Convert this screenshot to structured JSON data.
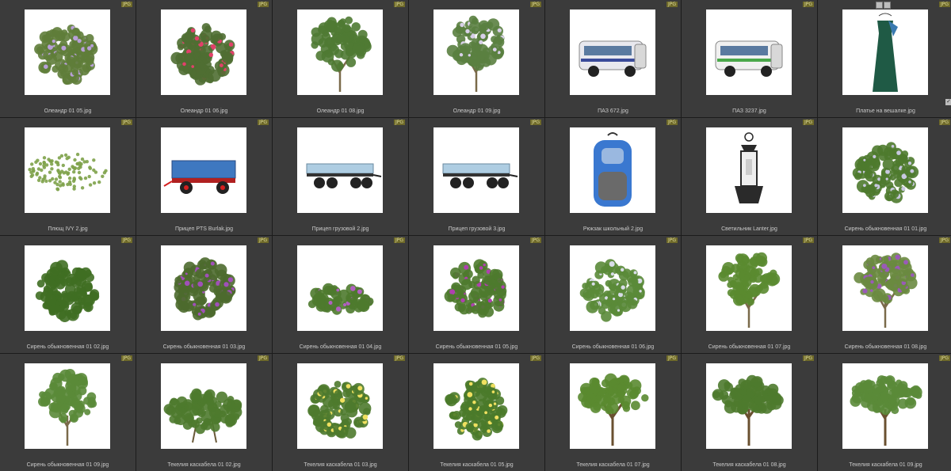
{
  "badge_text": "JPG",
  "items": [
    {
      "name": "Олеандр 01 05.jpg",
      "icon": "round-bush-lilac-flowers-icon",
      "kind": "round",
      "color": "#5f7d3a",
      "flower": "#b8a0d8"
    },
    {
      "name": "Олеандр 01 06.jpg",
      "icon": "round-bush-pink-flowers-icon",
      "kind": "round",
      "color": "#4f6e32",
      "flower": "#e2406a"
    },
    {
      "name": "Олеандр 01 08.jpg",
      "icon": "small-tree-icon",
      "kind": "tree",
      "color": "#4f7a33",
      "flower": ""
    },
    {
      "name": "Олеандр 01 09.jpg",
      "icon": "flowering-tree-icon",
      "kind": "tree",
      "color": "#5a8040",
      "flower": "#d8d0e8"
    },
    {
      "name": "ПАЗ 672.jpg",
      "icon": "bus-icon",
      "kind": "bus",
      "color": "#e8e8ee",
      "flower": "#3a4a9a"
    },
    {
      "name": "ПАЗ 3237.jpg",
      "icon": "bus-icon",
      "kind": "bus2",
      "color": "#f0f0f0",
      "flower": "#4aa84a"
    },
    {
      "name": "Платье на вешалке.jpg",
      "icon": "dress-on-hanger-icon",
      "kind": "dress",
      "color": "#1f5a45",
      "flower": "#3a7ab0"
    },
    {
      "name": "Плющ IVY 2.jpg",
      "icon": "ivy-groundcover-icon",
      "kind": "ivy",
      "color": "#7ea24a",
      "flower": ""
    },
    {
      "name": "Прицеп PTS Burlak.jpg",
      "icon": "farm-trailer-icon",
      "kind": "trailer",
      "color": "#3e78c0",
      "flower": "#d42020"
    },
    {
      "name": "Прицеп грузовой 2.jpg",
      "icon": "cargo-trailer-icon",
      "kind": "flatbed",
      "color": "#aecde2",
      "flower": "#222222"
    },
    {
      "name": "Прицеп грузовой 3.jpg",
      "icon": "cargo-trailer-icon",
      "kind": "flatbed",
      "color": "#aecde2",
      "flower": "#222222"
    },
    {
      "name": "Рюкзак школьный 2.jpg",
      "icon": "backpack-icon",
      "kind": "backpack",
      "color": "#3a78d0",
      "flower": "#6a6a6a"
    },
    {
      "name": "Светильник Lanter.jpg",
      "icon": "lantern-icon",
      "kind": "lantern",
      "color": "#2a2a2a",
      "flower": "#cccccc"
    },
    {
      "name": "Сирень обыкновенная 01 01.jpg",
      "icon": "lilac-bush-icon",
      "kind": "bush",
      "color": "#4e7a2e",
      "flower": "#c8c8e0"
    },
    {
      "name": "Сирень обыкновенная 01 02.jpg",
      "icon": "round-bush-icon",
      "kind": "round",
      "color": "#3f6e22",
      "flower": ""
    },
    {
      "name": "Сирень обыкновенная 01 03.jpg",
      "icon": "round-bush-purple-flowers-icon",
      "kind": "round",
      "color": "#4c6a2e",
      "flower": "#a050b8"
    },
    {
      "name": "Сирень обыкновенная 01 04.jpg",
      "icon": "low-bush-icon",
      "kind": "low",
      "color": "#4e7a2e",
      "flower": "#b060c0"
    },
    {
      "name": "Сирень обыкновенная 01 05.jpg",
      "icon": "lilac-bush-icon",
      "kind": "bush",
      "color": "#4e7a2e",
      "flower": "#b040b0"
    },
    {
      "name": "Сирень обыкновенная 01 06.jpg",
      "icon": "lilac-bush-icon",
      "kind": "bush",
      "color": "#5a8a38",
      "flower": "#d8dce8"
    },
    {
      "name": "Сирень обыкновенная 01 07.jpg",
      "icon": "small-tree-icon",
      "kind": "tree",
      "color": "#5a8a30",
      "flower": ""
    },
    {
      "name": "Сирень обыкновенная 01 08.jpg",
      "icon": "lilac-tree-icon",
      "kind": "tree",
      "color": "#6a8a40",
      "flower": "#9a5ab8"
    },
    {
      "name": "Сирень обыкновенная 01 09.jpg",
      "icon": "small-tree-icon",
      "kind": "tree",
      "color": "#5a8a38",
      "flower": ""
    },
    {
      "name": "Текелия каскабела 01 02.jpg",
      "icon": "wide-bush-icon",
      "kind": "wide",
      "color": "#4e7a2e",
      "flower": ""
    },
    {
      "name": "Текелия каскабела 01 03.jpg",
      "icon": "flowering-bush-icon",
      "kind": "bush",
      "color": "#4e7a2e",
      "flower": "#f0e060"
    },
    {
      "name": "Текелия каскабела 01 05.jpg",
      "icon": "flowering-bush-icon",
      "kind": "bush",
      "color": "#4a7a2a",
      "flower": "#f0e060"
    },
    {
      "name": "Текелия каскабела 01 07.jpg",
      "icon": "umbrella-tree-icon",
      "kind": "umbrella",
      "color": "#5a8a30",
      "flower": ""
    },
    {
      "name": "Текелия каскабела 01 08.jpg",
      "icon": "umbrella-tree-icon",
      "kind": "umbrella",
      "color": "#4e7a2e",
      "flower": ""
    },
    {
      "name": "Текелия каскабела 01 09.jpg",
      "icon": "umbrella-tree-icon",
      "kind": "umbrella",
      "color": "#5a8a38",
      "flower": ""
    }
  ]
}
